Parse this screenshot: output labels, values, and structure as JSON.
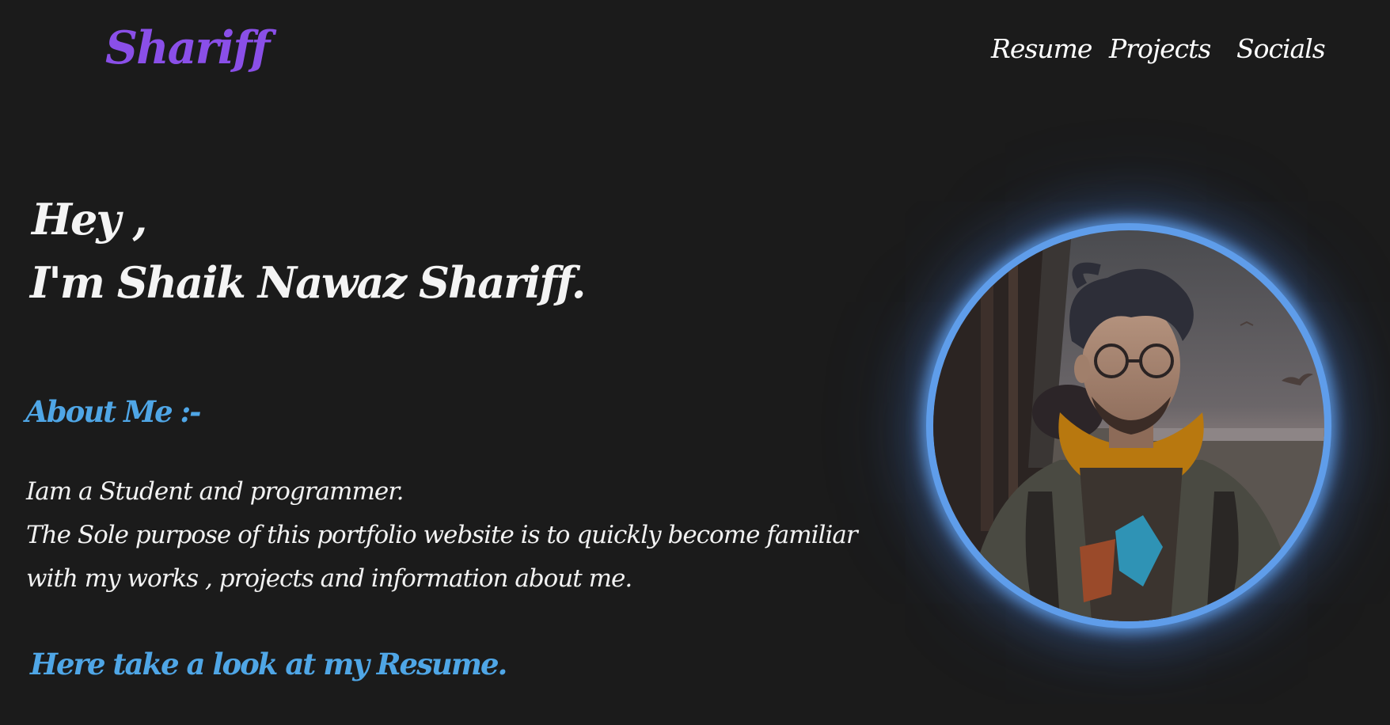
{
  "header": {
    "logo": "Shariff",
    "nav": {
      "resume": "Resume",
      "projects": "Projects",
      "socials": "Socials"
    }
  },
  "hero": {
    "greeting": "Hey ,",
    "intro": "I'm Shaik Nawaz Shariff."
  },
  "about": {
    "heading": "About Me :-",
    "lines": [
      "Iam a Student and programmer.",
      "The Sole purpose of this portfolio website is to quickly become familiar",
      "with my works , projects and information about me."
    ]
  },
  "resume_link": "Here take a look at my Resume.",
  "colors": {
    "background": "#1b1b1b",
    "logo": "#8a4fe8",
    "accent": "#4fa6e6",
    "text": "#ffffff",
    "avatar_glow": "#5f9dea"
  }
}
